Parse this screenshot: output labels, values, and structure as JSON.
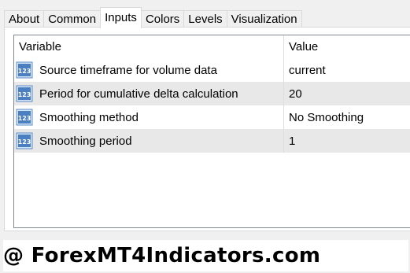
{
  "tabs": [
    {
      "label": "About",
      "active": false
    },
    {
      "label": "Common",
      "active": false
    },
    {
      "label": "Inputs",
      "active": true
    },
    {
      "label": "Colors",
      "active": false
    },
    {
      "label": "Levels",
      "active": false
    },
    {
      "label": "Visualization",
      "active": false
    }
  ],
  "table": {
    "columns": [
      "Variable",
      "Value"
    ],
    "rows": [
      {
        "icon": "numeric-param-icon",
        "icon_text": "123",
        "variable": "Source timeframe for volume data",
        "value": "current"
      },
      {
        "icon": "numeric-param-icon",
        "icon_text": "123",
        "variable": "Period for cumulative delta calculation",
        "value": "20"
      },
      {
        "icon": "numeric-param-icon",
        "icon_text": "123",
        "variable": "Smoothing method",
        "value": "No Smoothing"
      },
      {
        "icon": "numeric-param-icon",
        "icon_text": "123",
        "variable": "Smoothing period",
        "value": "1"
      }
    ]
  },
  "watermark": "@ ForexMT4Indicators.com",
  "colors": {
    "background": "#f0f0f0",
    "panel": "#ffffff",
    "alt_row": "#e8e8e8",
    "icon_fill": "#4a7fc1"
  }
}
